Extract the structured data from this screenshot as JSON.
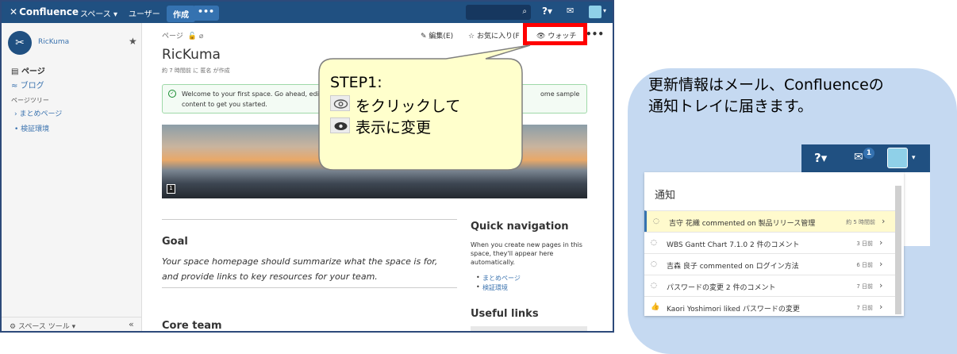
{
  "topbar": {
    "logo": "Confluence",
    "nav_spaces": "スペース",
    "nav_users": "ユーザー",
    "create": "作成",
    "more": "•••",
    "help_icon": "?"
  },
  "sidebar": {
    "space_name": "RicKuma",
    "nav_pages": "ページ",
    "nav_blog": "ブログ",
    "tree_heading": "ページツリー",
    "tree_items": [
      "まとめページ",
      "検証環境"
    ],
    "tools": "スペース ツール"
  },
  "page": {
    "breadcrumb": "ページ",
    "edit": "編集(E)",
    "favorite": "お気に入り(F",
    "watch": "ウォッチ",
    "title": "RicKuma",
    "meta": "約 7 時間前 に 匿名 が作成",
    "notice_line1": "Welcome to your first space. Go ahead, edi",
    "notice_line2": "content to get you started.",
    "notice_line3": "ome sample",
    "banner_badge": "1",
    "goal_heading": "Goal",
    "goal_text_1": "Your space homepage should summarize what the space is for,",
    "goal_text_2": "and provide links to key resources for your team.",
    "core_heading": "Core team",
    "quicknav_heading": "Quick navigation",
    "quicknav_text_1": "When you create new pages in this",
    "quicknav_text_2": "space, they'll appear here",
    "quicknav_text_3": "automatically.",
    "quicknav_links": [
      "まとめページ",
      "検証環境"
    ],
    "useful_heading": "Useful links"
  },
  "callout": {
    "title": "STEP1:",
    "line1": "をクリックして",
    "line2": "表示に変更"
  },
  "right": {
    "text_1": "更新情報はメール、Confluenceの",
    "text_2": "通知トレイに届きます。",
    "tray_count": "1",
    "help_icon": "?",
    "panel_title": "通知",
    "notifications": [
      {
        "text": "吉守 花織 commented on 製品リリース管理",
        "time": "約 5 時間前"
      },
      {
        "text": "WBS Gantt Chart 7.1.0 2 件のコメント",
        "time": "3 日前"
      },
      {
        "text": "吉森 良子 commented on ログイン方法",
        "time": "6 日前"
      },
      {
        "text": "パスワードの変更 2 件のコメント",
        "time": "7 日前"
      },
      {
        "text": "Kaori Yoshimori liked パスワードの変更",
        "time": "7 日前"
      }
    ]
  },
  "colors": {
    "header": "#205081",
    "highlight": "#ff0000",
    "callout_fill": "#ffffcc",
    "panel_bg": "#c5d9f1"
  }
}
